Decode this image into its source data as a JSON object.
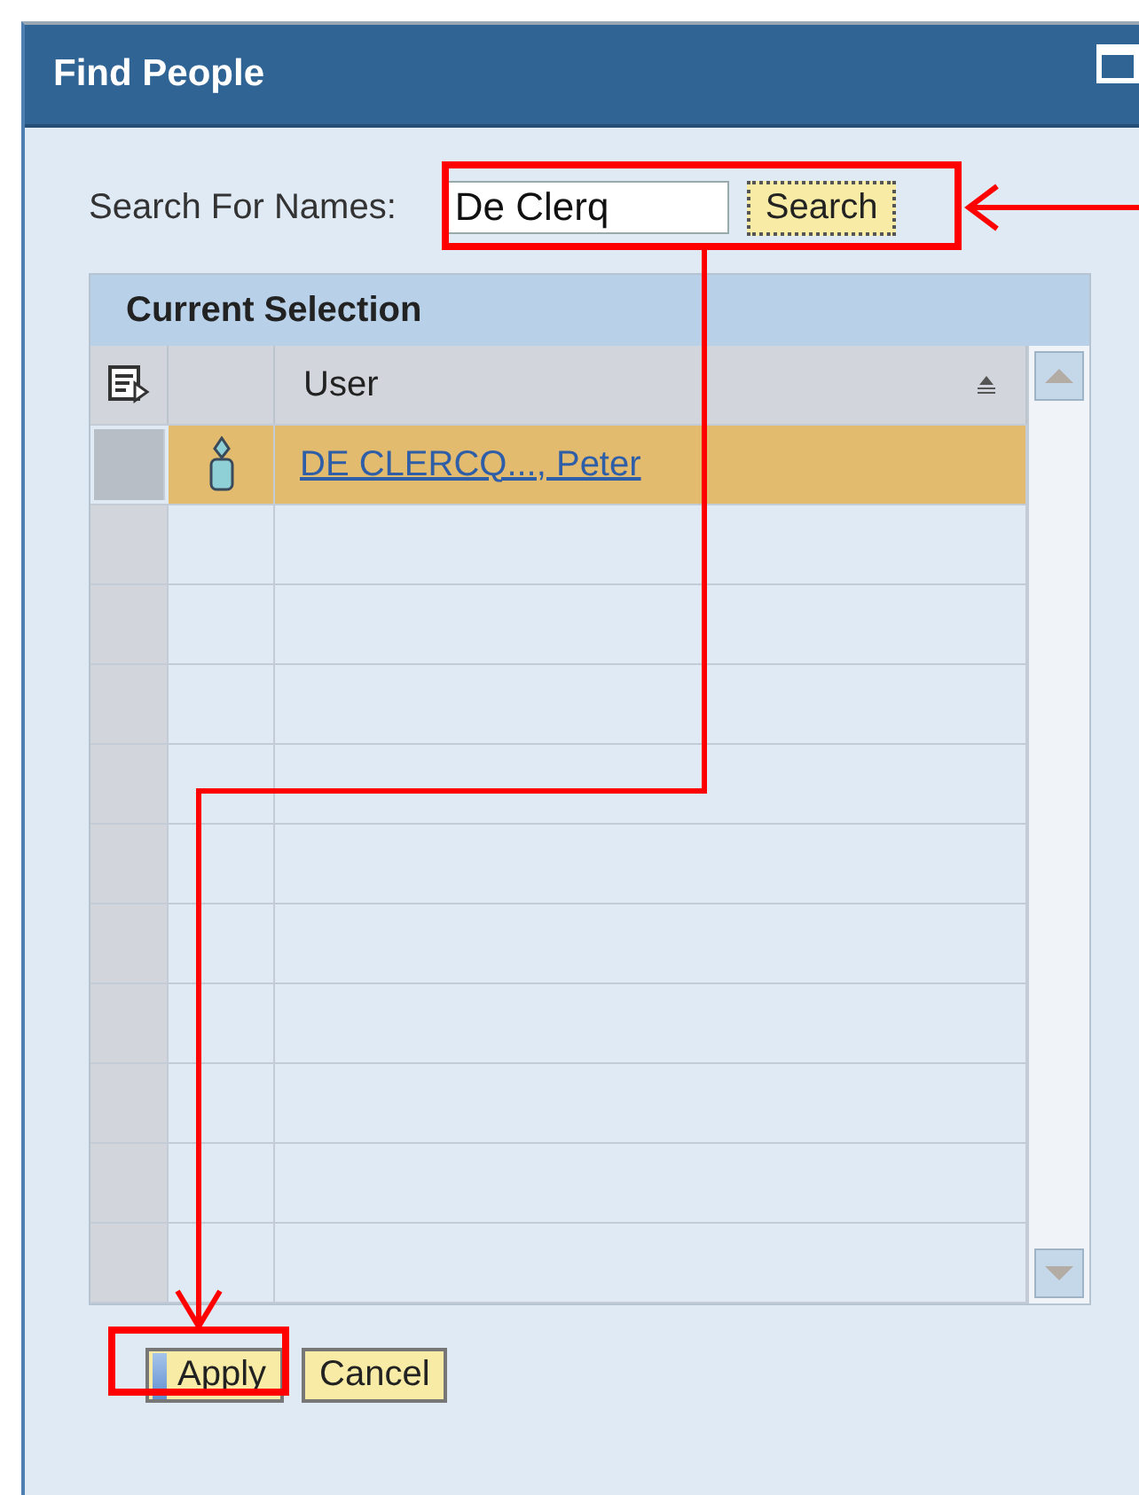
{
  "window": {
    "title": "Find People"
  },
  "search": {
    "label": "Search For Names:",
    "value": "De Clerq",
    "button": "Search"
  },
  "table": {
    "title": "Current Selection",
    "columns": [
      "User"
    ],
    "rows": [
      {
        "user": "DE CLERCQ..., Peter",
        "selected": true
      }
    ]
  },
  "buttons": [
    {
      "label": "Apply",
      "focused": true
    },
    {
      "label": "Cancel",
      "focused": false
    }
  ]
}
